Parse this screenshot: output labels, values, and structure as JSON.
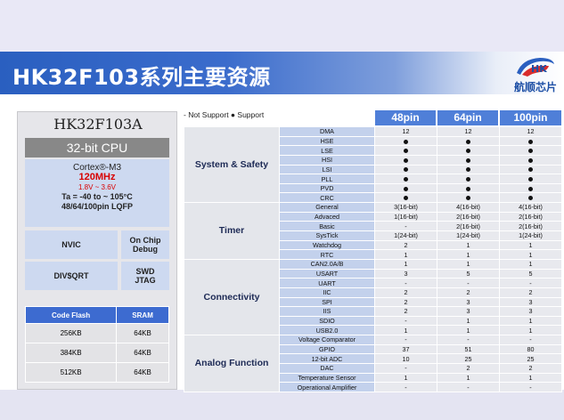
{
  "title": "HK32F103系列主要资源",
  "logo": {
    "text": "航顺芯片"
  },
  "chip": {
    "name": "HK32F103A",
    "cpu_header": "32-bit CPU",
    "core": "Cortex®-M3",
    "freq": "120MHz",
    "voltage": "1.8V ~ 3.6V",
    "temp": "Ta = -40 to ~ 105°C",
    "packages": "48/64/100pin LQFP",
    "blocks": {
      "nvic": "NVIC",
      "onchip1": "On Chip",
      "onchip2": "Debug",
      "div": "DIV$QRT",
      "swd1": "SWD",
      "swd2": "JTAG"
    },
    "memory": {
      "headers": [
        "Code Flash",
        "SRAM"
      ],
      "rows": [
        [
          "256KB",
          "64KB"
        ],
        [
          "384KB",
          "64KB"
        ],
        [
          "512KB",
          "64KB"
        ]
      ]
    }
  },
  "legend": "- Not Support ● Support",
  "pins": [
    "48pin",
    "64pin",
    "100pin"
  ],
  "groups": [
    {
      "name": "System & Safety",
      "rows": [
        [
          "DMA",
          "12",
          "12",
          "12"
        ],
        [
          "HSE",
          "●",
          "●",
          "●"
        ],
        [
          "LSE",
          "●",
          "●",
          "●"
        ],
        [
          "HSI",
          "●",
          "●",
          "●"
        ],
        [
          "LSI",
          "●",
          "●",
          "●"
        ],
        [
          "PLL",
          "●",
          "●",
          "●"
        ],
        [
          "PVD",
          "●",
          "●",
          "●"
        ],
        [
          "CRC",
          "●",
          "●",
          "●"
        ]
      ]
    },
    {
      "name": "Timer",
      "rows": [
        [
          "General",
          "3(16-bit)",
          "4(16-bit)",
          "4(16-bit)"
        ],
        [
          "Advaced",
          "1(16-bit)",
          "2(16-bit)",
          "2(16-bit)"
        ],
        [
          "Basic",
          "-",
          "2(16-bit)",
          "2(16-bit)"
        ],
        [
          "SysTick",
          "1(24-bit)",
          "1(24-bit)",
          "1(24-bit)"
        ],
        [
          "Watchdog",
          "2",
          "1",
          "1"
        ],
        [
          "RTC",
          "1",
          "1",
          "1"
        ]
      ]
    },
    {
      "name": "Connectivity",
      "rows": [
        [
          "CAN2.0A/B",
          "1",
          "1",
          "1"
        ],
        [
          "USART",
          "3",
          "5",
          "5"
        ],
        [
          "UART",
          "-",
          "-",
          "-"
        ],
        [
          "IIC",
          "2",
          "2",
          "2"
        ],
        [
          "SPI",
          "2",
          "3",
          "3"
        ],
        [
          "IIS",
          "2",
          "3",
          "3"
        ],
        [
          "SDIO",
          "-",
          "1",
          "1"
        ],
        [
          "USB2.0",
          "1",
          "1",
          "1"
        ]
      ]
    },
    {
      "name": "Analog Function",
      "rows": [
        [
          "Voltage Comparator",
          "-",
          "-",
          "-"
        ],
        [
          "GPIO",
          "37",
          "51",
          "80"
        ],
        [
          "12-bit ADC",
          "10",
          "25",
          "25"
        ],
        [
          "DAC",
          "-",
          "2",
          "2"
        ],
        [
          "Temperature Sensor",
          "1",
          "1",
          "1"
        ],
        [
          "Operational Amplifier",
          "-",
          "-",
          "-"
        ]
      ]
    }
  ],
  "colors": {
    "header_blue": "#2a5fc0",
    "pin_header": "#4f7fd8",
    "feature_cell": "#c3d1ec",
    "freq_red": "#d80000"
  }
}
